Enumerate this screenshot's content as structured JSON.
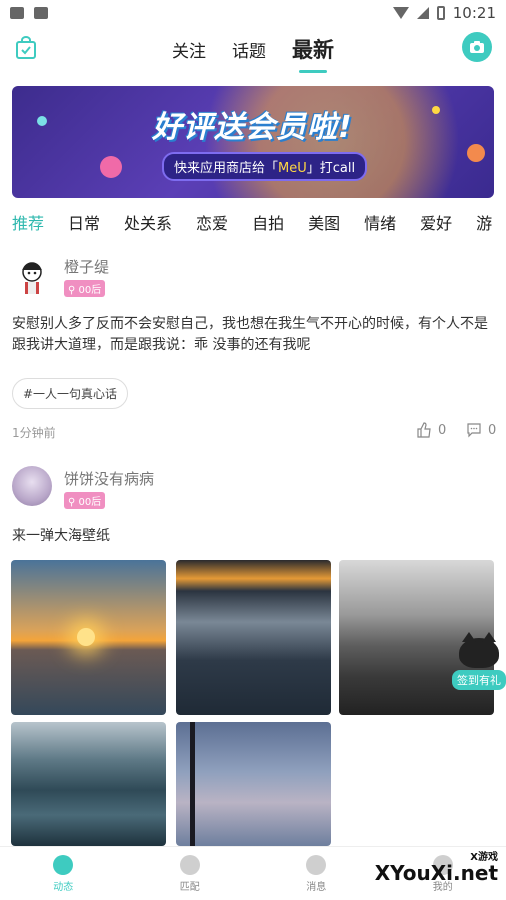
{
  "status_bar": {
    "time": "10:21"
  },
  "header": {
    "tabs": [
      {
        "label": "关注",
        "active": false
      },
      {
        "label": "话题",
        "active": false
      },
      {
        "label": "最新",
        "active": true
      }
    ]
  },
  "banner": {
    "title": "好评送会员啦!",
    "subtitle_prefix": "快来应用商店给「",
    "subtitle_highlight": "MeU",
    "subtitle_suffix": "」打call"
  },
  "categories": [
    {
      "label": "推荐",
      "active": true
    },
    {
      "label": "日常",
      "active": false
    },
    {
      "label": "处关系",
      "active": false
    },
    {
      "label": "恋爱",
      "active": false
    },
    {
      "label": "自拍",
      "active": false
    },
    {
      "label": "美图",
      "active": false
    },
    {
      "label": "情绪",
      "active": false
    },
    {
      "label": "爱好",
      "active": false
    },
    {
      "label": "游",
      "active": false
    }
  ],
  "posts": [
    {
      "username": "橙子缇",
      "badge": "00后",
      "text": "安慰别人多了反而不会安慰自己，我也想在我生气不开心的时候，有个人不是跟我讲大道理，而是跟我说：乖 没事的还有我呢",
      "topic": "#一人一句真心话",
      "time": "1分钟前",
      "likes": "0",
      "comments": "0"
    },
    {
      "username": "饼饼没有病病",
      "badge": "00后",
      "text": "来一弹大海壁纸"
    }
  ],
  "sign_in_label": "签到有礼",
  "bottom_nav": [
    {
      "label": "动态",
      "active": true
    },
    {
      "label": "匹配",
      "active": false
    },
    {
      "label": "消息",
      "active": false
    },
    {
      "label": "我的",
      "active": false
    }
  ],
  "watermark": {
    "small": "X游戏",
    "main": "XYouXi.net"
  },
  "colors": {
    "accent": "#3ecbc0",
    "badge": "#f08fc1"
  }
}
